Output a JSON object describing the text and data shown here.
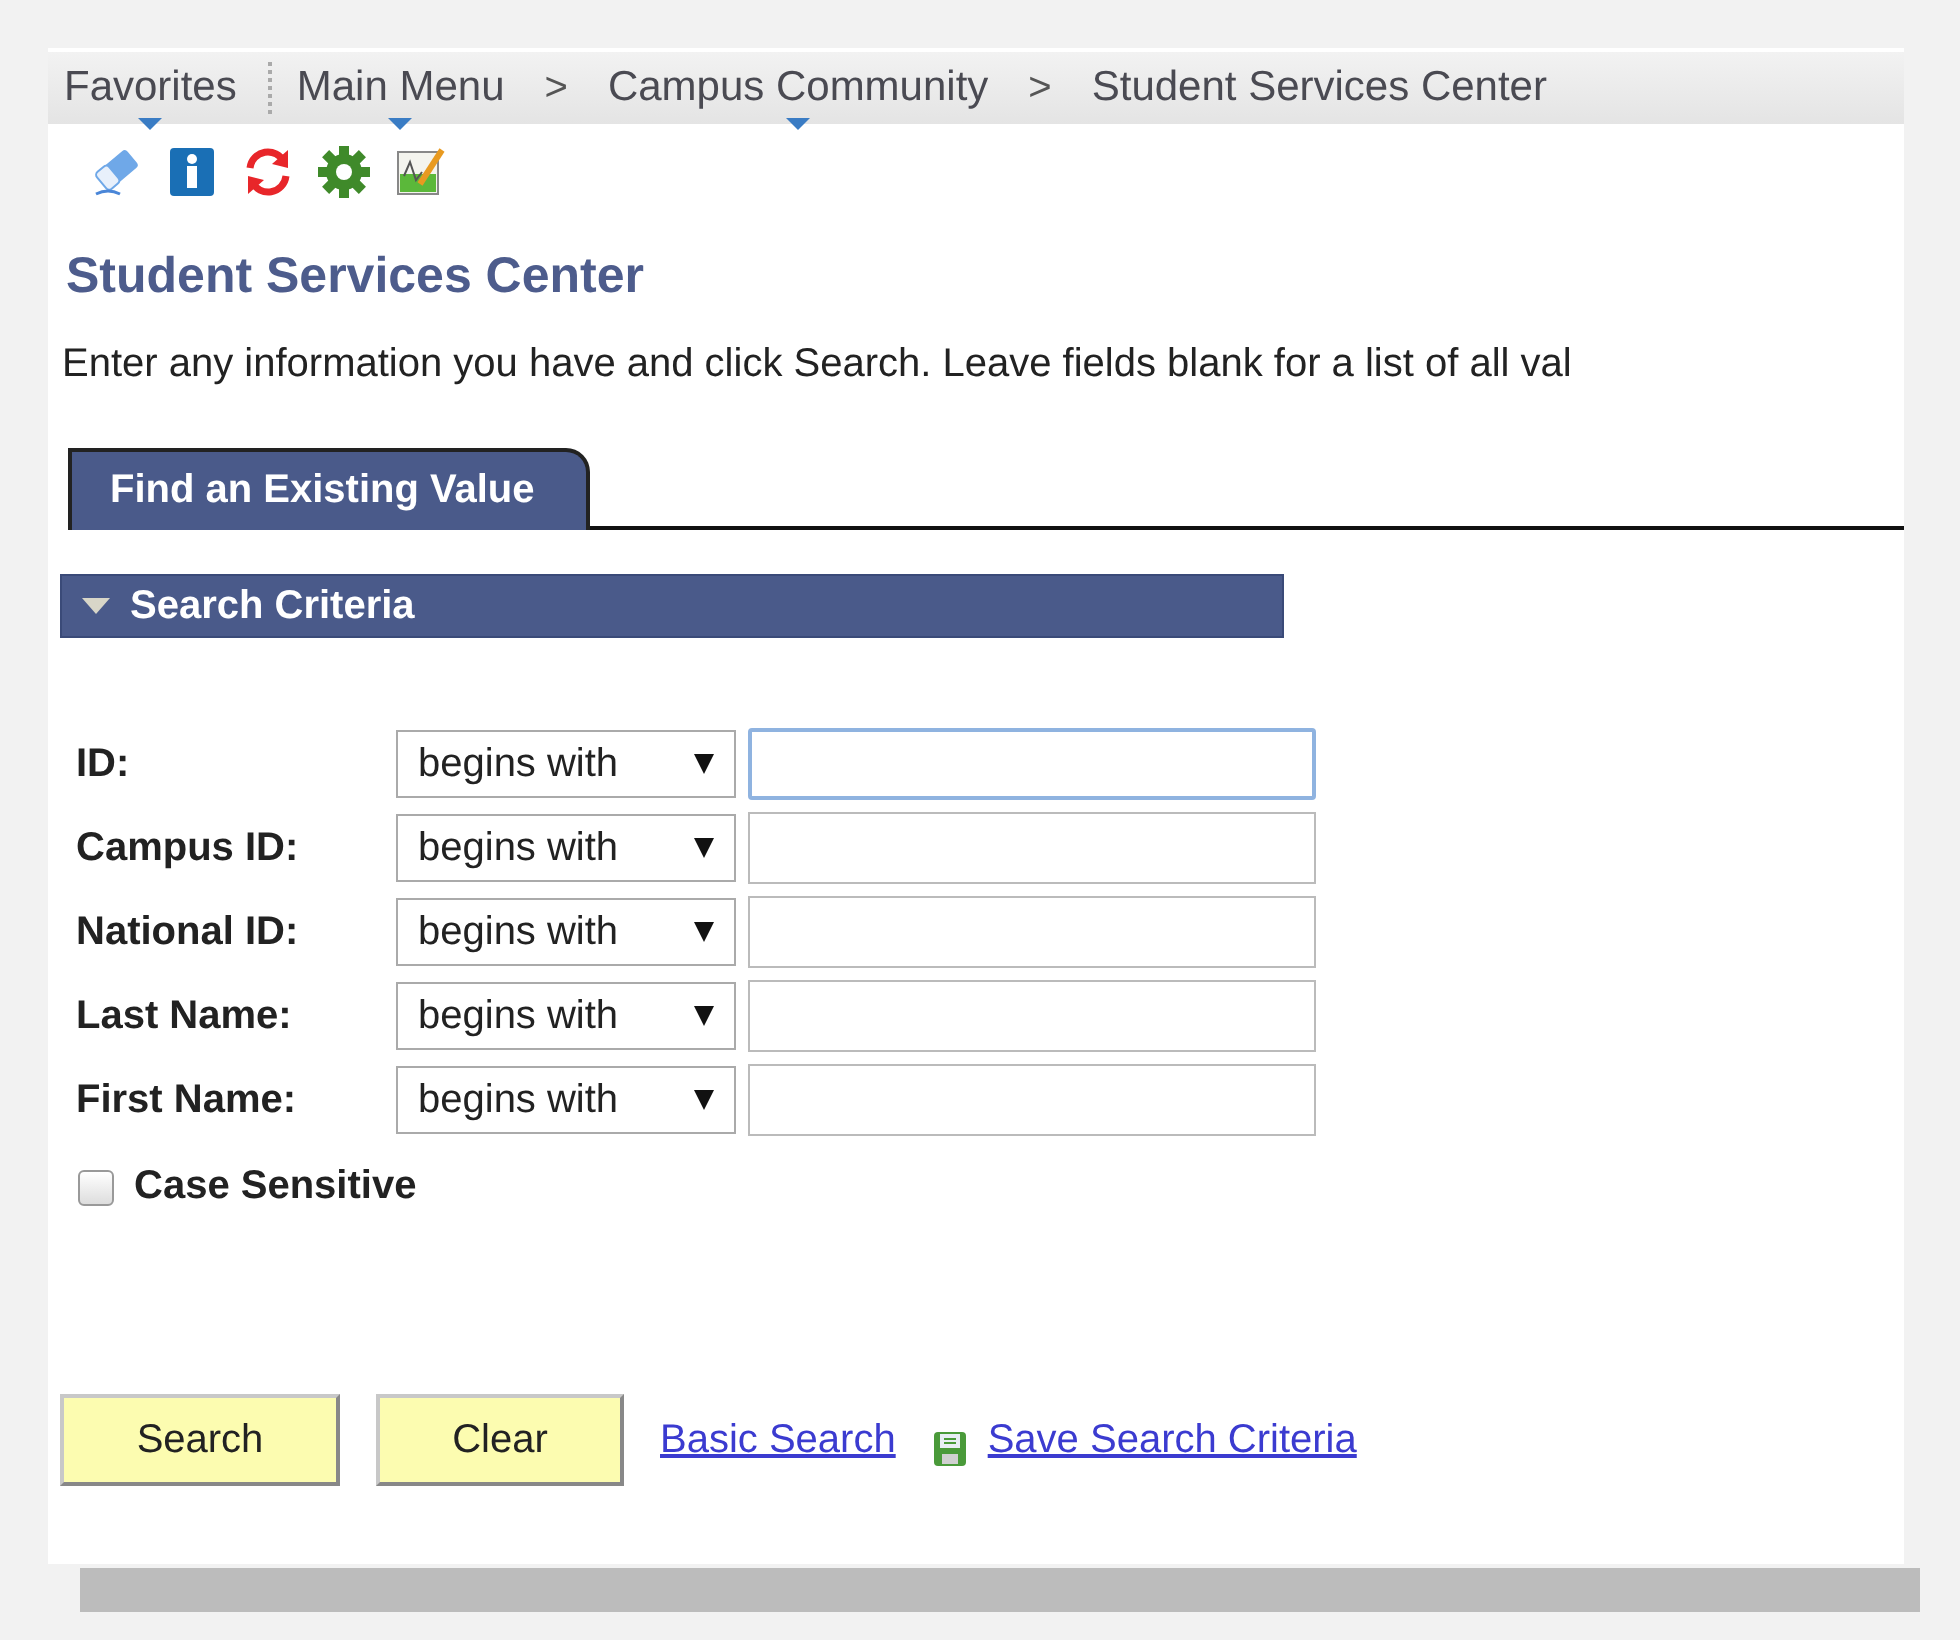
{
  "breadcrumbs": [
    {
      "kind": "menu",
      "label": "Favorites",
      "menu": true
    },
    {
      "kind": "divider"
    },
    {
      "kind": "menu",
      "label": "Main Menu",
      "menu": true
    },
    {
      "kind": "separator",
      "label": ">"
    },
    {
      "kind": "menu",
      "label": "Campus Community",
      "menu": true
    },
    {
      "kind": "separator",
      "label": ">"
    },
    {
      "kind": "menu",
      "label": "Student Services Center",
      "menu": false
    }
  ],
  "toolbar": [
    {
      "kind": "eraser"
    },
    {
      "kind": "info"
    },
    {
      "kind": "refresh"
    },
    {
      "kind": "gear"
    },
    {
      "kind": "chart"
    }
  ],
  "page_title": "Student Services Center",
  "instructions": "Enter any information you have and click Search. Leave fields blank for a list of all val",
  "tabs": [
    {
      "label": "Find an Existing Value",
      "selected": true
    }
  ],
  "section": {
    "title": "Search Criteria",
    "expanded": true
  },
  "fields": [
    {
      "label": "ID:",
      "operator": "begins with",
      "focused": true
    },
    {
      "label": "Campus ID:",
      "operator": "begins with",
      "focused": false
    },
    {
      "label": "National ID:",
      "operator": "begins with",
      "focused": false
    },
    {
      "label": "Last Name:",
      "operator": "begins with",
      "focused": false
    },
    {
      "label": "First Name:",
      "operator": "begins with",
      "focused": false
    }
  ],
  "case_sensitive": {
    "label": "Case Sensitive",
    "checked": false
  },
  "buttons": [
    "Search",
    "Clear"
  ],
  "links": [
    {
      "kind": "link",
      "label": "Basic Search"
    },
    {
      "kind": "save",
      "label": "Save Search Criteria"
    }
  ]
}
